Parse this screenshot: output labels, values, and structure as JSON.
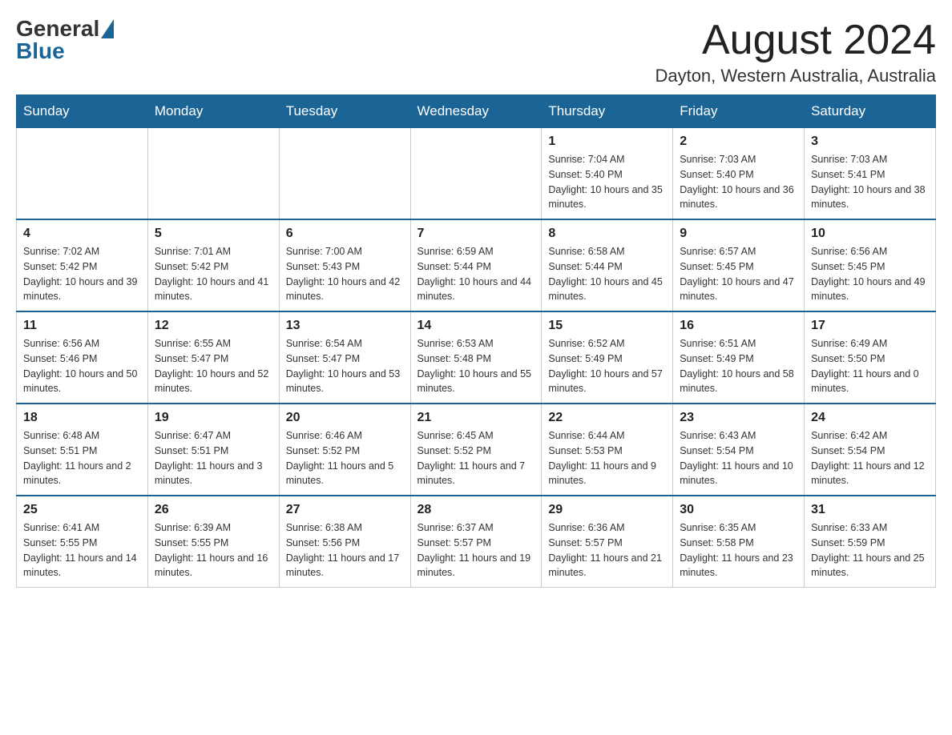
{
  "header": {
    "logo_general": "General",
    "logo_blue": "Blue",
    "month_title": "August 2024",
    "location": "Dayton, Western Australia, Australia"
  },
  "calendar": {
    "days_of_week": [
      "Sunday",
      "Monday",
      "Tuesday",
      "Wednesday",
      "Thursday",
      "Friday",
      "Saturday"
    ],
    "weeks": [
      [
        {
          "day": "",
          "info": ""
        },
        {
          "day": "",
          "info": ""
        },
        {
          "day": "",
          "info": ""
        },
        {
          "day": "",
          "info": ""
        },
        {
          "day": "1",
          "info": "Sunrise: 7:04 AM\nSunset: 5:40 PM\nDaylight: 10 hours and 35 minutes."
        },
        {
          "day": "2",
          "info": "Sunrise: 7:03 AM\nSunset: 5:40 PM\nDaylight: 10 hours and 36 minutes."
        },
        {
          "day": "3",
          "info": "Sunrise: 7:03 AM\nSunset: 5:41 PM\nDaylight: 10 hours and 38 minutes."
        }
      ],
      [
        {
          "day": "4",
          "info": "Sunrise: 7:02 AM\nSunset: 5:42 PM\nDaylight: 10 hours and 39 minutes."
        },
        {
          "day": "5",
          "info": "Sunrise: 7:01 AM\nSunset: 5:42 PM\nDaylight: 10 hours and 41 minutes."
        },
        {
          "day": "6",
          "info": "Sunrise: 7:00 AM\nSunset: 5:43 PM\nDaylight: 10 hours and 42 minutes."
        },
        {
          "day": "7",
          "info": "Sunrise: 6:59 AM\nSunset: 5:44 PM\nDaylight: 10 hours and 44 minutes."
        },
        {
          "day": "8",
          "info": "Sunrise: 6:58 AM\nSunset: 5:44 PM\nDaylight: 10 hours and 45 minutes."
        },
        {
          "day": "9",
          "info": "Sunrise: 6:57 AM\nSunset: 5:45 PM\nDaylight: 10 hours and 47 minutes."
        },
        {
          "day": "10",
          "info": "Sunrise: 6:56 AM\nSunset: 5:45 PM\nDaylight: 10 hours and 49 minutes."
        }
      ],
      [
        {
          "day": "11",
          "info": "Sunrise: 6:56 AM\nSunset: 5:46 PM\nDaylight: 10 hours and 50 minutes."
        },
        {
          "day": "12",
          "info": "Sunrise: 6:55 AM\nSunset: 5:47 PM\nDaylight: 10 hours and 52 minutes."
        },
        {
          "day": "13",
          "info": "Sunrise: 6:54 AM\nSunset: 5:47 PM\nDaylight: 10 hours and 53 minutes."
        },
        {
          "day": "14",
          "info": "Sunrise: 6:53 AM\nSunset: 5:48 PM\nDaylight: 10 hours and 55 minutes."
        },
        {
          "day": "15",
          "info": "Sunrise: 6:52 AM\nSunset: 5:49 PM\nDaylight: 10 hours and 57 minutes."
        },
        {
          "day": "16",
          "info": "Sunrise: 6:51 AM\nSunset: 5:49 PM\nDaylight: 10 hours and 58 minutes."
        },
        {
          "day": "17",
          "info": "Sunrise: 6:49 AM\nSunset: 5:50 PM\nDaylight: 11 hours and 0 minutes."
        }
      ],
      [
        {
          "day": "18",
          "info": "Sunrise: 6:48 AM\nSunset: 5:51 PM\nDaylight: 11 hours and 2 minutes."
        },
        {
          "day": "19",
          "info": "Sunrise: 6:47 AM\nSunset: 5:51 PM\nDaylight: 11 hours and 3 minutes."
        },
        {
          "day": "20",
          "info": "Sunrise: 6:46 AM\nSunset: 5:52 PM\nDaylight: 11 hours and 5 minutes."
        },
        {
          "day": "21",
          "info": "Sunrise: 6:45 AM\nSunset: 5:52 PM\nDaylight: 11 hours and 7 minutes."
        },
        {
          "day": "22",
          "info": "Sunrise: 6:44 AM\nSunset: 5:53 PM\nDaylight: 11 hours and 9 minutes."
        },
        {
          "day": "23",
          "info": "Sunrise: 6:43 AM\nSunset: 5:54 PM\nDaylight: 11 hours and 10 minutes."
        },
        {
          "day": "24",
          "info": "Sunrise: 6:42 AM\nSunset: 5:54 PM\nDaylight: 11 hours and 12 minutes."
        }
      ],
      [
        {
          "day": "25",
          "info": "Sunrise: 6:41 AM\nSunset: 5:55 PM\nDaylight: 11 hours and 14 minutes."
        },
        {
          "day": "26",
          "info": "Sunrise: 6:39 AM\nSunset: 5:55 PM\nDaylight: 11 hours and 16 minutes."
        },
        {
          "day": "27",
          "info": "Sunrise: 6:38 AM\nSunset: 5:56 PM\nDaylight: 11 hours and 17 minutes."
        },
        {
          "day": "28",
          "info": "Sunrise: 6:37 AM\nSunset: 5:57 PM\nDaylight: 11 hours and 19 minutes."
        },
        {
          "day": "29",
          "info": "Sunrise: 6:36 AM\nSunset: 5:57 PM\nDaylight: 11 hours and 21 minutes."
        },
        {
          "day": "30",
          "info": "Sunrise: 6:35 AM\nSunset: 5:58 PM\nDaylight: 11 hours and 23 minutes."
        },
        {
          "day": "31",
          "info": "Sunrise: 6:33 AM\nSunset: 5:59 PM\nDaylight: 11 hours and 25 minutes."
        }
      ]
    ]
  }
}
